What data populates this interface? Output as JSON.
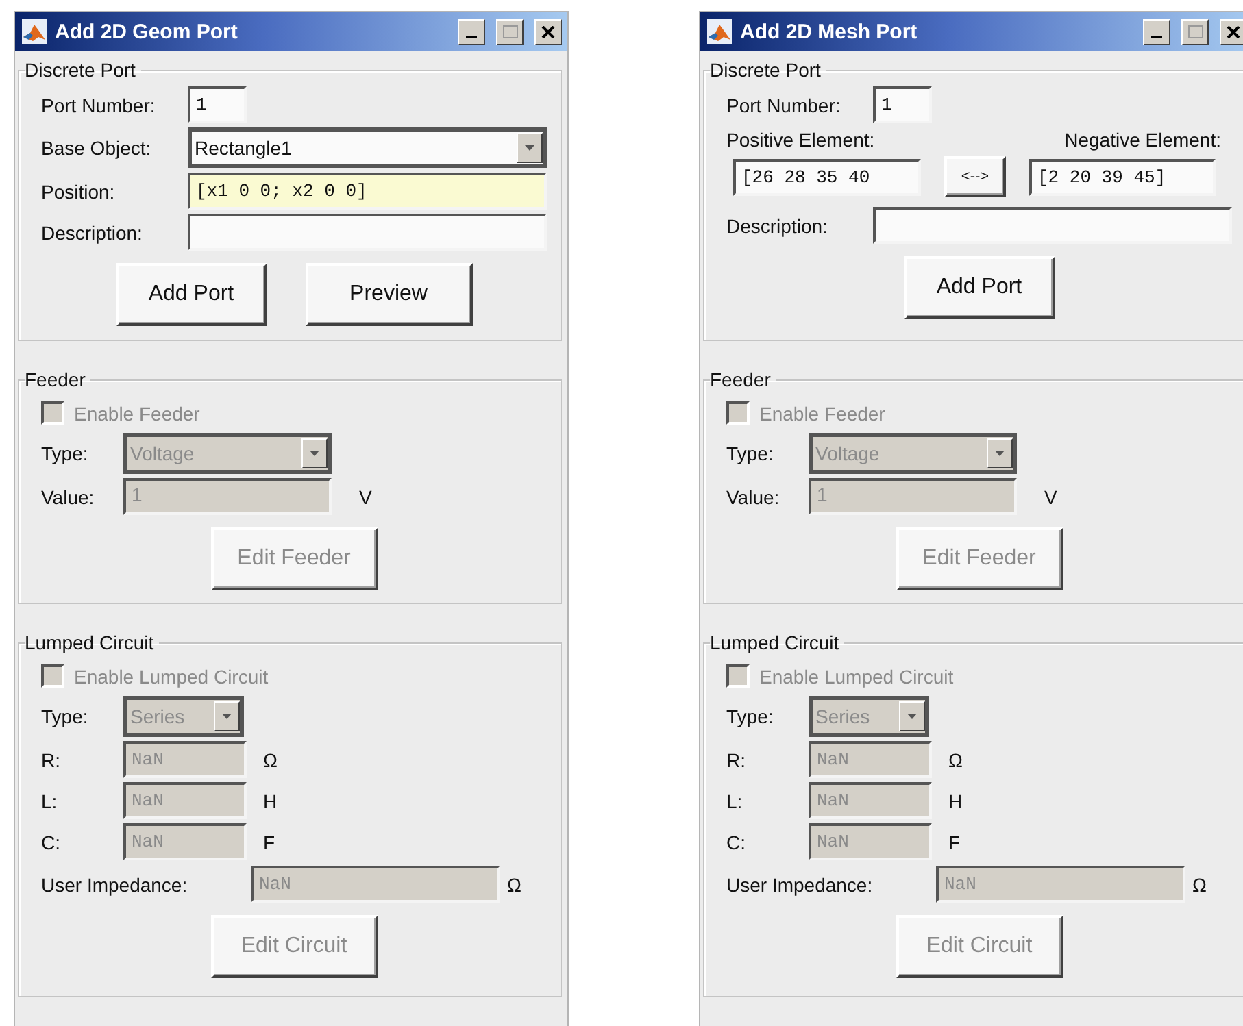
{
  "windows": [
    {
      "title": "Add 2D Geom Port",
      "discrete_port": {
        "title": "Discrete Port",
        "fields": [
          {
            "kind": "number",
            "label": "Port Number:",
            "value": "1"
          },
          {
            "kind": "dropdown",
            "label": "Base Object:",
            "value": "Rectangle1"
          },
          {
            "kind": "code",
            "label": "Position:",
            "value": "[x1 0 0; x2 0 0]",
            "highlighted": true
          },
          {
            "kind": "text",
            "label": "Description:"
          }
        ],
        "buttons": [
          "Add Port",
          "Preview"
        ]
      },
      "feeder": {
        "title": "Feeder",
        "disabled": true,
        "enable": {
          "label": "Enable Feeder",
          "checked": false
        },
        "type": {
          "label": "Type:",
          "value": "Voltage"
        },
        "value": {
          "label": "Value:",
          "value": "1",
          "unit": "V"
        },
        "button": "Edit Feeder"
      },
      "lumped": {
        "title": "Lumped Circuit",
        "disabled": true,
        "enable": {
          "label": "Enable Lumped Circuit",
          "checked": false
        },
        "type": {
          "label": "Type:",
          "value": "Series"
        },
        "params": [
          {
            "label": "R:",
            "value": "NaN",
            "unit": "Ω"
          },
          {
            "label": "L:",
            "value": "NaN",
            "unit": "H"
          },
          {
            "label": "C:",
            "value": "NaN",
            "unit": "F"
          }
        ],
        "impedance": {
          "label": "User Impedance:",
          "value": "NaN",
          "unit": "Ω"
        },
        "button": "Edit Circuit"
      }
    },
    {
      "title": "Add 2D Mesh Port",
      "discrete_port": {
        "title": "Discrete Port",
        "fields": [
          {
            "kind": "number",
            "label": "Port Number:",
            "value": "1"
          },
          {
            "kind": "elements",
            "positive": {
              "label": "Positive Element:",
              "value": "[26 28 35 40"
            },
            "swap": "<-->",
            "negative": {
              "label": "Negative Element:",
              "value": "[2 20 39 45]"
            }
          },
          {
            "kind": "text",
            "label": "Description:"
          }
        ],
        "buttons": [
          "Add Port"
        ]
      },
      "feeder": {
        "title": "Feeder",
        "disabled": true,
        "enable": {
          "label": "Enable Feeder",
          "checked": false
        },
        "type": {
          "label": "Type:",
          "value": "Voltage"
        },
        "value": {
          "label": "Value:",
          "value": "1",
          "unit": "V"
        },
        "button": "Edit Feeder"
      },
      "lumped": {
        "title": "Lumped Circuit",
        "disabled": true,
        "enable": {
          "label": "Enable Lumped Circuit",
          "checked": false
        },
        "type": {
          "label": "Type:",
          "value": "Series"
        },
        "params": [
          {
            "label": "R:",
            "value": "NaN",
            "unit": "Ω"
          },
          {
            "label": "L:",
            "value": "NaN",
            "unit": "H"
          },
          {
            "label": "C:",
            "value": "NaN",
            "unit": "F"
          }
        ],
        "impedance": {
          "label": "User Impedance:",
          "value": "NaN",
          "unit": "Ω"
        },
        "button": "Edit Circuit"
      }
    }
  ]
}
